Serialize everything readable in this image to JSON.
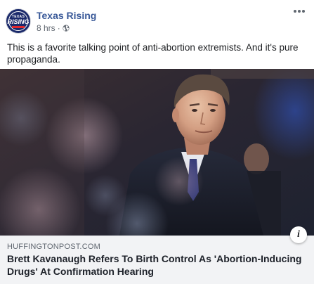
{
  "post": {
    "page_name": "Texas Rising",
    "avatar": {
      "logo_top": "TEXAS",
      "logo_main": "RISING",
      "colors": {
        "background": "#1b2a6b",
        "accent": "#e0282e"
      }
    },
    "timestamp": "8 hrs",
    "separator": "·",
    "privacy_icon": "globe-icon",
    "more_icon": "ellipsis-icon",
    "text": "This is a favorite talking point of anti-abortion extremists. And it's pure propaganda."
  },
  "link_preview": {
    "image_description_icon": "photo",
    "domain": "HUFFINGTONPOST.COM",
    "title": "Brett Kavanaugh Refers To Birth Control As 'Abortion-Inducing Drugs' At Confirmation Hearing",
    "info_icon": "info-icon",
    "info_label": "i"
  },
  "colors": {
    "page_name": "#385898",
    "meta": "#606770",
    "link_box_bg": "#f2f3f5"
  }
}
